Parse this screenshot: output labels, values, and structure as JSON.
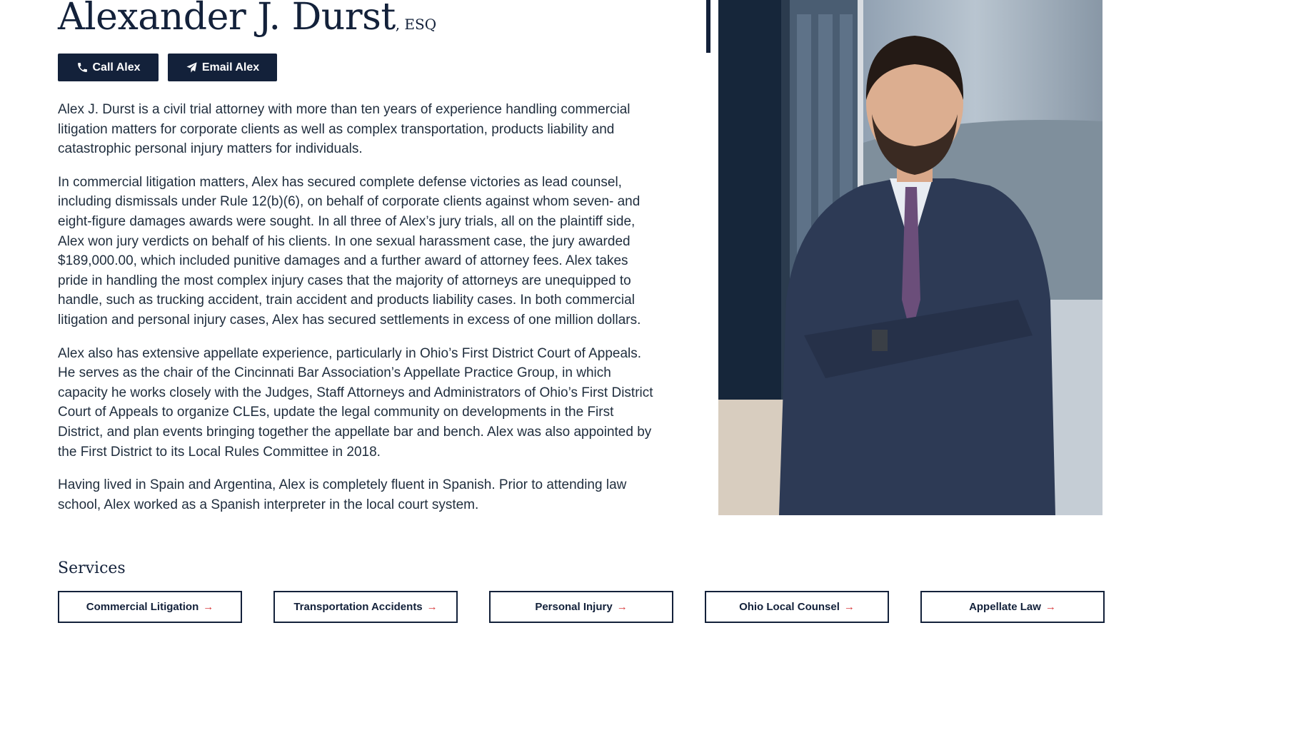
{
  "profile": {
    "name": "Alexander J. Durst",
    "suffix": ", ESQ"
  },
  "actions": {
    "call_label": "Call Alex",
    "email_label": "Email Alex",
    "call_icon": "phone-icon",
    "email_icon": "paper-plane-icon"
  },
  "bio": [
    "Alex J. Durst is a civil trial attorney with more than ten years of experience handling commercial litigation matters for corporate clients as well as complex transportation, products liability and catastrophic personal injury matters for individuals.",
    "In commercial litigation matters, Alex has secured complete defense victories as lead counsel, including dismissals under Rule 12(b)(6), on behalf of corporate clients against whom seven- and eight-figure damages awards were sought. In all three of Alex’s jury trials, all on the plaintiff side, Alex won jury verdicts on behalf of his clients. In one sexual harassment case, the jury awarded $189,000.00, which included punitive damages and a further award of attorney fees. Alex takes pride in handling the most complex injury cases that the majority of attorneys are unequipped to handle, such as trucking accident, train accident and products liability cases. In both commercial litigation and personal injury cases, Alex has secured settlements in excess of one million dollars.",
    "Alex also has extensive appellate experience, particularly in Ohio’s First District Court of Appeals. He serves as the chair of the Cincinnati Bar Association’s Appellate Practice Group, in which capacity he works closely with the Judges, Staff Attorneys and Administrators of Ohio’s First District Court of Appeals to organize CLEs, update the legal community on developments in the First District, and plan events bringing together the appellate bar and bench. Alex was also appointed by the First District to its Local Rules Committee in 2018.",
    "Having lived in Spain and Argentina, Alex is completely fluent in Spanish. Prior to attending law school, Alex worked as a Spanish interpreter in the local court system."
  ],
  "services": {
    "title": "Services",
    "arrow": "→",
    "items": [
      "Commercial Litigation",
      "Transportation Accidents",
      "Personal Injury",
      "Ohio Local Counsel",
      "Appellate Law"
    ]
  },
  "colors": {
    "navy": "#13213a",
    "text": "#1f2d3d",
    "accent_arrow": "#d9383a",
    "background": "#ffffff"
  }
}
